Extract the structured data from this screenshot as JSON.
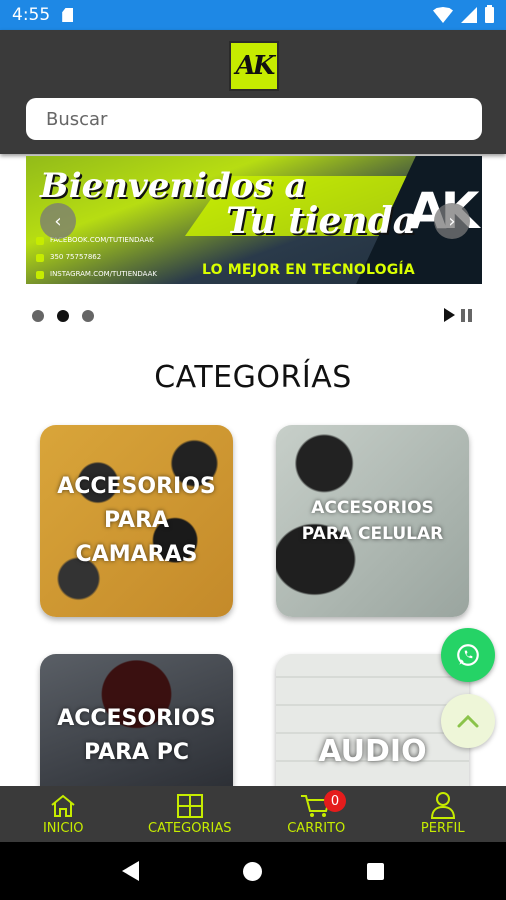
{
  "status_bar": {
    "time": "4:55"
  },
  "header": {
    "logo_text": "AK"
  },
  "search": {
    "placeholder": "Buscar"
  },
  "banner": {
    "title_line1": "Bienvenidos a",
    "title_line2": "Tu tienda",
    "brand": "AK",
    "social": [
      "FACEBOOK.COM/TUTIENDAAK",
      "350 75757862",
      "INSTAGRAM.COM/TUTIENDAAK"
    ],
    "tagline": "LO MEJOR EN TECNOLOGÍA",
    "prev_symbol": "‹",
    "next_symbol": "›",
    "slide_count": 3,
    "active_slide": 2
  },
  "categories": {
    "title": "CATEGORÍAS",
    "items": [
      {
        "label": "ACCESORIOS PARA CAMARAS"
      },
      {
        "label": "ACCESORIOS PARA CELULAR"
      },
      {
        "label": "ACCESORIOS PARA PC"
      },
      {
        "label": "AUDIO"
      }
    ]
  },
  "bottom_nav": {
    "items": [
      {
        "label": "INICIO",
        "icon": "home-icon"
      },
      {
        "label": "CATEGORIAS",
        "icon": "grid-icon"
      },
      {
        "label": "CARRITO",
        "icon": "cart-icon",
        "badge": "0"
      },
      {
        "label": "PERFIL",
        "icon": "user-icon"
      }
    ]
  },
  "colors": {
    "accent": "#c6ec00",
    "dark": "#3a3a3a",
    "status_bar": "#1e88e5",
    "whatsapp": "#25d366",
    "badge": "#e51c1c"
  }
}
